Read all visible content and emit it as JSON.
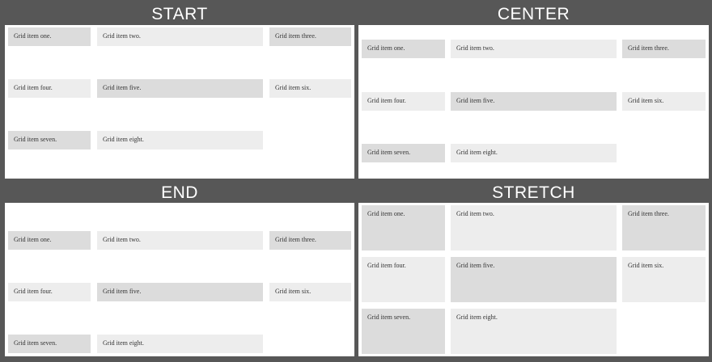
{
  "panels": [
    {
      "title": "START",
      "items": [
        {
          "label": "Grid item one.",
          "shade": "dark"
        },
        {
          "label": "Grid item two.",
          "shade": "light"
        },
        {
          "label": "Grid item three.",
          "shade": "dark"
        },
        {
          "label": "Grid item four.",
          "shade": "light"
        },
        {
          "label": "Grid item five.",
          "shade": "dark"
        },
        {
          "label": "Grid item six.",
          "shade": "light"
        },
        {
          "label": "Grid item seven.",
          "shade": "dark"
        },
        {
          "label": "Grid item eight.",
          "shade": "light"
        }
      ]
    },
    {
      "title": "CENTER",
      "items": [
        {
          "label": "Grid item one.",
          "shade": "dark"
        },
        {
          "label": "Grid item two.",
          "shade": "light"
        },
        {
          "label": "Grid item three.",
          "shade": "dark"
        },
        {
          "label": "Grid item four.",
          "shade": "light"
        },
        {
          "label": "Grid item five.",
          "shade": "dark"
        },
        {
          "label": "Grid item six.",
          "shade": "light"
        },
        {
          "label": "Grid item seven.",
          "shade": "dark"
        },
        {
          "label": "Grid item eight.",
          "shade": "light"
        }
      ]
    },
    {
      "title": "END",
      "items": [
        {
          "label": "Grid item one.",
          "shade": "dark"
        },
        {
          "label": "Grid item two.",
          "shade": "light"
        },
        {
          "label": "Grid item three.",
          "shade": "dark"
        },
        {
          "label": "Grid item four.",
          "shade": "light"
        },
        {
          "label": "Grid item five.",
          "shade": "dark"
        },
        {
          "label": "Grid item six.",
          "shade": "light"
        },
        {
          "label": "Grid item seven.",
          "shade": "dark"
        },
        {
          "label": "Grid item eight.",
          "shade": "light"
        }
      ]
    },
    {
      "title": "STRETCH",
      "items": [
        {
          "label": "Grid item one.",
          "shade": "dark"
        },
        {
          "label": "Grid item two.",
          "shade": "light"
        },
        {
          "label": "Grid item three.",
          "shade": "dark"
        },
        {
          "label": "Grid item four.",
          "shade": "light"
        },
        {
          "label": "Grid item five.",
          "shade": "dark"
        },
        {
          "label": "Grid item six.",
          "shade": "light"
        },
        {
          "label": "Grid item seven.",
          "shade": "dark"
        },
        {
          "label": "Grid item eight.",
          "shade": "light"
        }
      ]
    }
  ]
}
